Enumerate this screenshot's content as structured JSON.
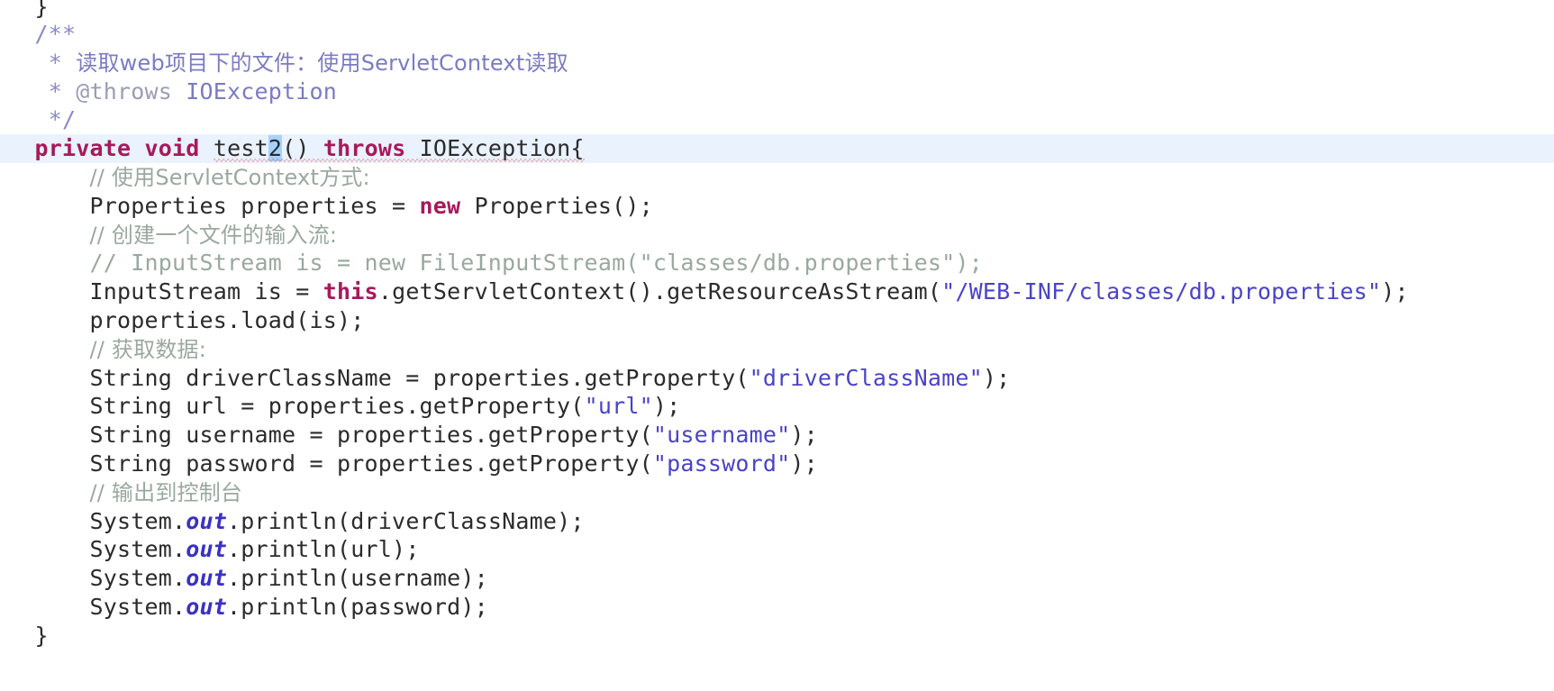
{
  "editor": {
    "language": "Java",
    "colors": {
      "background": "#ffffff",
      "default_text": "#2b2b2b",
      "keyword": "#a61a5c",
      "line_comment": "#9aa8a0",
      "javadoc": "#7b7bc4",
      "javadoc_tag": "#9c9cb5",
      "string_literal": "#4a43c8",
      "static_field": "#3a31c4",
      "current_line_highlight": "#e9f2fd",
      "selection": "#a6d2ff",
      "error_squiggle": "#e04a4a",
      "caret": "#1f1f1f"
    },
    "caret": {
      "line_index": 5,
      "selected_text": "2"
    },
    "current_line_index": 5,
    "lines": [
      {
        "index": 0,
        "clipped": true,
        "current": false,
        "tokens": [
          {
            "t": "  ",
            "k": "default"
          },
          {
            "t": "}",
            "k": "punct"
          }
        ]
      },
      {
        "index": 1,
        "current": false,
        "tokens": [
          {
            "t": "  ",
            "k": "default"
          },
          {
            "t": "/**",
            "k": "doc"
          }
        ]
      },
      {
        "index": 2,
        "current": false,
        "tokens": [
          {
            "t": "   * ",
            "k": "doc"
          },
          {
            "t": "读取web项目下的文件：使用ServletContext读取",
            "k": "doc-text"
          }
        ]
      },
      {
        "index": 3,
        "current": false,
        "tokens": [
          {
            "t": "   * ",
            "k": "doc"
          },
          {
            "t": "@throws",
            "k": "doc-tag"
          },
          {
            "t": " ",
            "k": "doc"
          },
          {
            "t": "IOException",
            "k": "doc-text"
          }
        ]
      },
      {
        "index": 4,
        "current": false,
        "tokens": [
          {
            "t": "   */",
            "k": "doc"
          }
        ]
      },
      {
        "index": 5,
        "current": true,
        "error_underline": true,
        "tokens": [
          {
            "t": "  ",
            "k": "default"
          },
          {
            "t": "private",
            "k": "keyword"
          },
          {
            "t": " ",
            "k": "default"
          },
          {
            "t": "void",
            "k": "keyword"
          },
          {
            "t": " ",
            "k": "default"
          },
          {
            "t": "test",
            "k": "ident"
          },
          {
            "t": "2",
            "k": "selection"
          },
          {
            "t": "() ",
            "k": "punct"
          },
          {
            "t": "throws",
            "k": "keyword"
          },
          {
            "t": " ",
            "k": "default"
          },
          {
            "t": "IOException{",
            "k": "ident"
          }
        ]
      },
      {
        "index": 6,
        "current": false,
        "tokens": [
          {
            "t": "      ",
            "k": "default"
          },
          {
            "t": "// 使用ServletContext方式:",
            "k": "comment"
          }
        ]
      },
      {
        "index": 7,
        "current": false,
        "tokens": [
          {
            "t": "      ",
            "k": "default"
          },
          {
            "t": "Properties properties = ",
            "k": "ident"
          },
          {
            "t": "new",
            "k": "keyword"
          },
          {
            "t": " Properties();",
            "k": "ident"
          }
        ]
      },
      {
        "index": 8,
        "current": false,
        "tokens": [
          {
            "t": "      ",
            "k": "default"
          },
          {
            "t": "// 创建一个文件的输入流:",
            "k": "comment"
          }
        ]
      },
      {
        "index": 9,
        "current": false,
        "tokens": [
          {
            "t": "      ",
            "k": "default"
          },
          {
            "t": "// InputStream is = new FileInputStream(\"classes/db.properties\");",
            "k": "comment"
          }
        ]
      },
      {
        "index": 10,
        "current": false,
        "tokens": [
          {
            "t": "      ",
            "k": "default"
          },
          {
            "t": "InputStream is = ",
            "k": "ident"
          },
          {
            "t": "this",
            "k": "keyword"
          },
          {
            "t": ".getServletContext().getResourceAsStream(",
            "k": "ident"
          },
          {
            "t": "\"/WEB-INF/classes/db.properties\"",
            "k": "string"
          },
          {
            "t": ");",
            "k": "punct"
          }
        ]
      },
      {
        "index": 11,
        "current": false,
        "tokens": [
          {
            "t": "      ",
            "k": "default"
          },
          {
            "t": "properties.load(is);",
            "k": "ident"
          }
        ]
      },
      {
        "index": 12,
        "current": false,
        "tokens": [
          {
            "t": "      ",
            "k": "default"
          },
          {
            "t": "// 获取数据:",
            "k": "comment"
          }
        ]
      },
      {
        "index": 13,
        "current": false,
        "tokens": [
          {
            "t": "      ",
            "k": "default"
          },
          {
            "t": "String driverClassName = properties.getProperty(",
            "k": "ident"
          },
          {
            "t": "\"driverClassName\"",
            "k": "string"
          },
          {
            "t": ");",
            "k": "punct"
          }
        ]
      },
      {
        "index": 14,
        "current": false,
        "tokens": [
          {
            "t": "      ",
            "k": "default"
          },
          {
            "t": "String url = properties.getProperty(",
            "k": "ident"
          },
          {
            "t": "\"url\"",
            "k": "string"
          },
          {
            "t": ");",
            "k": "punct"
          }
        ]
      },
      {
        "index": 15,
        "current": false,
        "tokens": [
          {
            "t": "      ",
            "k": "default"
          },
          {
            "t": "String username = properties.getProperty(",
            "k": "ident"
          },
          {
            "t": "\"username\"",
            "k": "string"
          },
          {
            "t": ");",
            "k": "punct"
          }
        ]
      },
      {
        "index": 16,
        "current": false,
        "tokens": [
          {
            "t": "      ",
            "k": "default"
          },
          {
            "t": "String password = properties.getProperty(",
            "k": "ident"
          },
          {
            "t": "\"password\"",
            "k": "string"
          },
          {
            "t": ");",
            "k": "punct"
          }
        ]
      },
      {
        "index": 17,
        "current": false,
        "tokens": [
          {
            "t": "      ",
            "k": "default"
          },
          {
            "t": "// 输出到控制台",
            "k": "comment"
          }
        ]
      },
      {
        "index": 18,
        "current": false,
        "tokens": [
          {
            "t": "      ",
            "k": "default"
          },
          {
            "t": "System.",
            "k": "ident"
          },
          {
            "t": "out",
            "k": "static"
          },
          {
            "t": ".println(driverClassName);",
            "k": "ident"
          }
        ]
      },
      {
        "index": 19,
        "current": false,
        "tokens": [
          {
            "t": "      ",
            "k": "default"
          },
          {
            "t": "System.",
            "k": "ident"
          },
          {
            "t": "out",
            "k": "static"
          },
          {
            "t": ".println(url);",
            "k": "ident"
          }
        ]
      },
      {
        "index": 20,
        "current": false,
        "tokens": [
          {
            "t": "      ",
            "k": "default"
          },
          {
            "t": "System.",
            "k": "ident"
          },
          {
            "t": "out",
            "k": "static"
          },
          {
            "t": ".println(username);",
            "k": "ident"
          }
        ]
      },
      {
        "index": 21,
        "current": false,
        "tokens": [
          {
            "t": "      ",
            "k": "default"
          },
          {
            "t": "System.",
            "k": "ident"
          },
          {
            "t": "out",
            "k": "static"
          },
          {
            "t": ".println(password);",
            "k": "ident"
          }
        ]
      },
      {
        "index": 22,
        "clipped_bottom": true,
        "current": false,
        "tokens": [
          {
            "t": "  ",
            "k": "default"
          },
          {
            "t": "}",
            "k": "punct"
          }
        ]
      }
    ]
  }
}
